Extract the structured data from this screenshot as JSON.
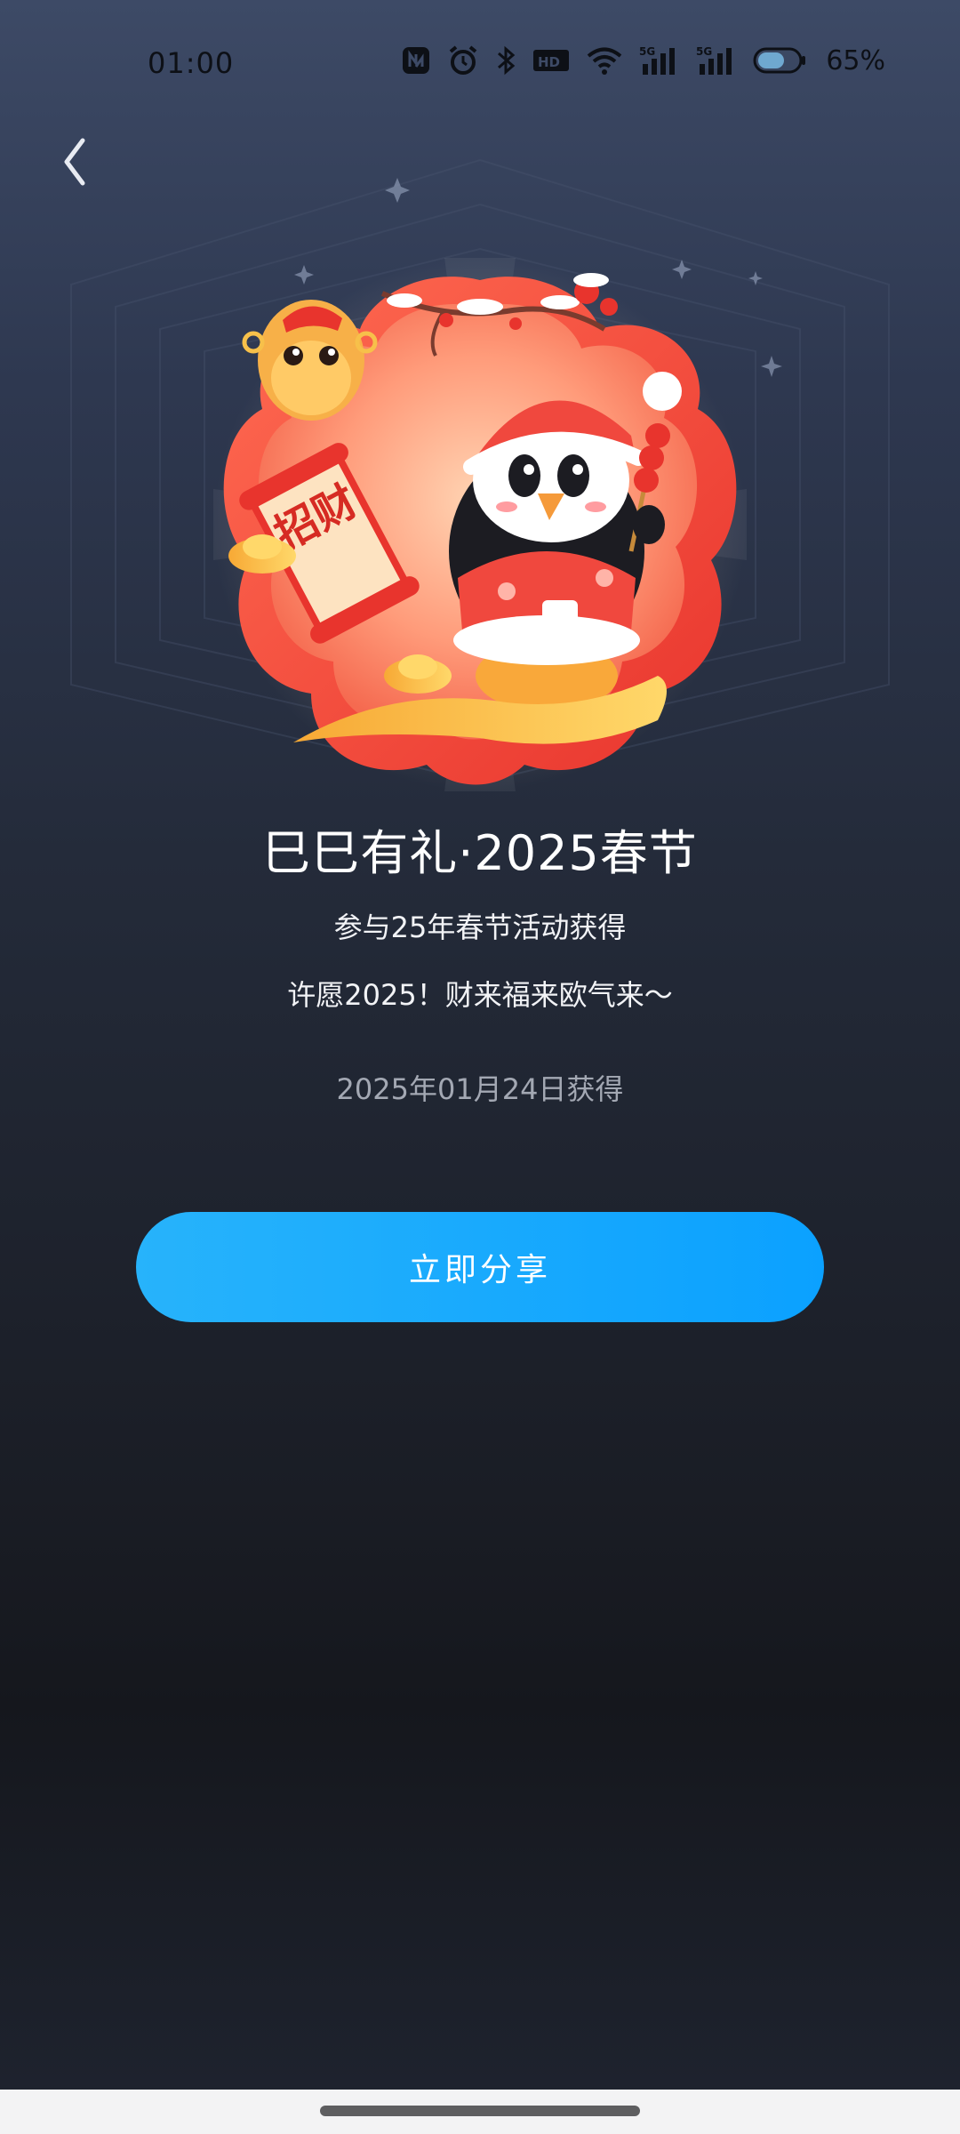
{
  "status_bar": {
    "time": "01:00",
    "icons": [
      "nfc-icon",
      "alarm-icon",
      "bluetooth-icon",
      "hd-icon",
      "wifi-icon",
      "signal-5g-icon",
      "signal-5g-icon",
      "battery-icon"
    ],
    "battery_percent_text": "65%",
    "battery_level": 0.65
  },
  "header": {
    "back_icon": "chevron-left-icon"
  },
  "badge": {
    "scroll_text": "招财",
    "image_description_icon": "spring-festival-badge"
  },
  "content": {
    "title": "巳巳有礼·2025春节",
    "subtitle": "参与25年春节活动获得",
    "wish": "许愿2025！财来福来欧气来～",
    "date": "2025年01月24日获得"
  },
  "actions": {
    "share_label": "立即分享"
  },
  "colors": {
    "accent": "#0ba1ff",
    "accent_light": "#27b3fb",
    "badge_red": "#f0483e",
    "badge_orange": "#ff8a6a",
    "gold": "#f7c04a"
  }
}
